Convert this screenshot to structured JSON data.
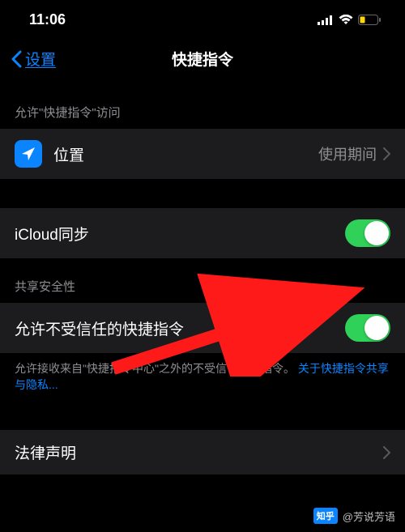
{
  "status_bar": {
    "time": "11:06"
  },
  "nav": {
    "back_label": "设置",
    "title": "快捷指令"
  },
  "section_access": {
    "header": "允许\"快捷指令\"访问",
    "location_label": "位置",
    "location_value": "使用期间"
  },
  "icloud": {
    "label": "iCloud同步",
    "enabled": true
  },
  "section_security": {
    "header": "共享安全性",
    "untrusted_label": "允许不受信任的快捷指令",
    "untrusted_enabled": true,
    "footer_text": "允许接收来自\"快捷指令中心\"之外的不受信任快捷指令。",
    "footer_link": "关于快捷指令共享与隐私..."
  },
  "legal": {
    "label": "法律声明"
  },
  "attribution": {
    "logo": "知乎",
    "author": "@芳说芳语"
  }
}
